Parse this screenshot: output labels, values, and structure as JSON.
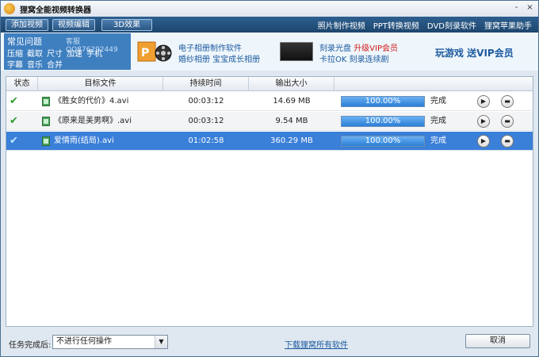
{
  "window": {
    "title": "狸窝全能视频转换器",
    "minimize": "-",
    "close": "×"
  },
  "toolbar": {
    "add_video": "添加视频",
    "edit_video": "视频编辑",
    "effects_3d": "3D效果",
    "links": [
      "照片制作视频",
      "PPT转换视频",
      "DVD刻录软件",
      "狸窝苹果助手"
    ]
  },
  "banner": {
    "faq_title": "常见问题",
    "faq_qq": "客服QQ876292449",
    "faq_row1": [
      "压缩",
      "截取",
      "尺寸",
      "加速",
      "手机"
    ],
    "faq_row2": [
      "字幕",
      "音乐",
      "合并"
    ],
    "ad1_line1": "电子相册制作软件",
    "ad1_line2": "婚纱相册 宝宝成长相册",
    "ad2_line1a": "刻录光盘",
    "ad2_line1b": "升级VIP会员",
    "ad2_line2": "卡拉OK 刻录连续剧",
    "promo": "玩游戏 送VIP会员"
  },
  "table": {
    "headers": [
      "状态",
      "目标文件",
      "持续时间",
      "输出大小"
    ],
    "rows": [
      {
        "file": "《胜女的代价》4.avi",
        "duration": "00:03:12",
        "size": "14.69 MB",
        "progress": "100.00%",
        "progress_value": 1.0,
        "status": "完成",
        "state": "normal"
      },
      {
        "file": "《原来是美男啊》.avi",
        "duration": "00:03:12",
        "size": "9.54 MB",
        "progress": "100.00%",
        "progress_value": 1.0,
        "status": "完成",
        "state": "alt"
      },
      {
        "file": "爱情雨(结局).avi",
        "duration": "01:02:58",
        "size": "360.29 MB",
        "progress": "100.00%",
        "progress_value": 1.0,
        "status": "完成",
        "state": "selected"
      }
    ]
  },
  "bottom": {
    "after_done_label": "任务完成后:",
    "after_done_value": "不进行任何操作",
    "download_link": "下载狸窝所有软件",
    "cancel": "取消"
  },
  "colors": {
    "toolbar_bg": "#1d466e",
    "selected_row": "#3a7fd8",
    "progress_fill": "#2b7fd6",
    "check": "#2e9b2e",
    "vip_red": "#d01818"
  }
}
